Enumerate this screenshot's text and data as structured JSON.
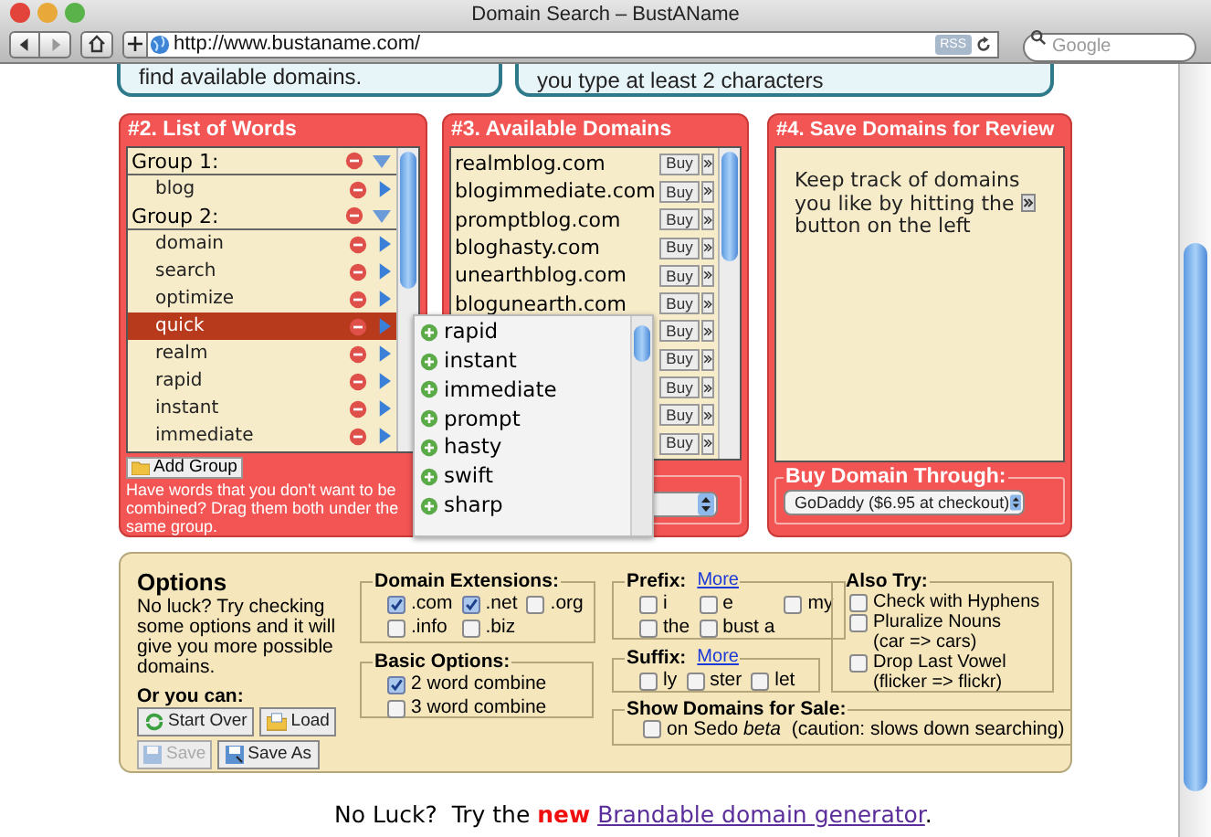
{
  "browser": {
    "title": "Domain Search – BustAName",
    "url": "http://www.bustaname.com/",
    "feed_badge": "RSS",
    "search": {
      "placeholder": "Google"
    }
  },
  "top_panels": [
    {
      "text": "find available domains."
    },
    {
      "text": "you type at least 2 characters"
    }
  ],
  "word_list": {
    "title": "#2. List of Words",
    "groups": [
      {
        "label": "Group 1:",
        "expanded": true,
        "children": [
          {
            "label": "blog",
            "selected": false
          }
        ]
      },
      {
        "label": "Group 2:",
        "expanded": true,
        "children": [
          {
            "label": "domain",
            "selected": false
          },
          {
            "label": "search",
            "selected": false
          },
          {
            "label": "optimize",
            "selected": false
          },
          {
            "label": "quick",
            "selected": true
          },
          {
            "label": "realm",
            "selected": false
          },
          {
            "label": "rapid",
            "selected": false
          },
          {
            "label": "instant",
            "selected": false
          },
          {
            "label": "immediate",
            "selected": false
          }
        ]
      }
    ],
    "add_group_button": "Add Group",
    "hint": "Have words that you don't want to be combined?  Drag them both under the same group."
  },
  "suggestions": [
    "rapid",
    "instant",
    "immediate",
    "prompt",
    "hasty",
    "swift",
    "sharp"
  ],
  "domains": {
    "title": "#3. Available Domains",
    "rows": [
      {
        "domain": "realmblog.com",
        "buy": "Buy"
      },
      {
        "domain": "blogimmediate.com",
        "buy": "Buy"
      },
      {
        "domain": "promptblog.com",
        "buy": "Buy"
      },
      {
        "domain": "bloghasty.com",
        "buy": "Buy"
      },
      {
        "domain": "unearthblog.com",
        "buy": "Buy"
      },
      {
        "domain": "blogunearth.com",
        "buy": "Buy"
      },
      {
        "buy": "Buy"
      },
      {
        "buy": "Buy"
      },
      {
        "buy": "Buy"
      },
      {
        "buy": "Buy"
      },
      {
        "buy": "Buy"
      }
    ]
  },
  "save_panel": {
    "title": "#4. Save Domains for Review",
    "message_before": "Keep track of domains you like by hitting the",
    "message_after": "button on the left",
    "buy_through": {
      "legend": "Buy Domain Through:",
      "value": "GoDaddy ($6.95 at checkout)"
    }
  },
  "options": {
    "title": "Options",
    "description": "No luck?  Try checking some options and it will give you more possible domains.",
    "actions_label": "Or you can:",
    "actions": [
      {
        "label": "Start Over",
        "kind": "refresh",
        "disabled": false
      },
      {
        "label": "Load",
        "kind": "open",
        "disabled": false
      },
      {
        "label": "Save",
        "kind": "save",
        "disabled": true
      },
      {
        "label": "Save As",
        "kind": "save-as",
        "disabled": false
      }
    ],
    "extensions": {
      "legend": "Domain Extensions:",
      "rows": [
        [
          {
            "label": ".com",
            "checked": true
          },
          {
            "label": ".net",
            "checked": true
          },
          {
            "label": ".org",
            "checked": false
          }
        ],
        [
          {
            "label": ".info",
            "checked": false
          },
          {
            "label": ".biz",
            "checked": false
          }
        ]
      ]
    },
    "basic": {
      "legend": "Basic Options:",
      "rows": [
        [
          {
            "label": "2 word combine",
            "checked": true
          }
        ],
        [
          {
            "label": "3 word combine",
            "checked": false
          }
        ]
      ]
    },
    "prefix": {
      "legend": "Prefix:",
      "link": "More",
      "rows": [
        [
          {
            "label": "i",
            "checked": false
          },
          {
            "label": "e",
            "checked": false
          },
          {
            "label": "my",
            "checked": false
          }
        ],
        [
          {
            "label": "the",
            "checked": false
          },
          {
            "label": "bust a",
            "checked": false
          }
        ]
      ]
    },
    "suffix": {
      "legend": "Suffix:",
      "link": "More",
      "rows": [
        [
          {
            "label": "ly",
            "checked": false
          },
          {
            "label": "ster",
            "checked": false
          },
          {
            "label": "let",
            "checked": false
          }
        ]
      ]
    },
    "also_try": {
      "legend": "Also Try:",
      "items": [
        {
          "label": "Check with Hyphens",
          "checked": false
        },
        {
          "label": "Pluralize Nouns",
          "note": "(car => cars)",
          "checked": false
        },
        {
          "label": "Drop Last Vowel",
          "note": "(flicker => flickr)",
          "checked": false
        }
      ]
    },
    "for_sale": {
      "legend": "Show Domains for Sale:",
      "label": "on Sedo *beta*  (caution: slows down searching)",
      "checked": false
    }
  },
  "footer": {
    "before": "No Luck?  Try the",
    "highlight": "new",
    "link": "Brandable domain generator",
    "after": "."
  }
}
